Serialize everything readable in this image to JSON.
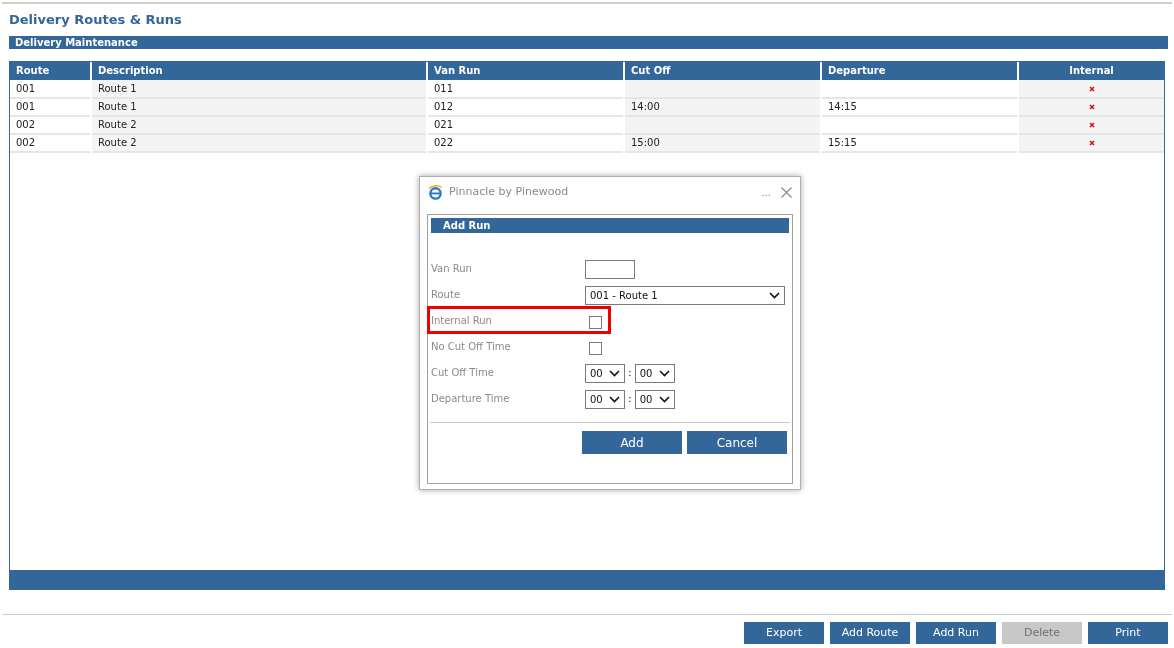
{
  "page_title": "Delivery Routes & Runs",
  "section_title": "Delivery Maintenance",
  "table": {
    "columns": [
      "Route",
      "Description",
      "Van Run",
      "Cut Off",
      "Departure",
      "Internal"
    ],
    "rows": [
      {
        "route": "001",
        "description": "Route 1",
        "van_run": "011",
        "cut_off": "",
        "departure": "",
        "internal": false
      },
      {
        "route": "001",
        "description": "Route 1",
        "van_run": "012",
        "cut_off": "14:00",
        "departure": "14:15",
        "internal": false
      },
      {
        "route": "002",
        "description": "Route 2",
        "van_run": "021",
        "cut_off": "",
        "departure": "",
        "internal": false
      },
      {
        "route": "002",
        "description": "Route 2",
        "van_run": "022",
        "cut_off": "15:00",
        "departure": "15:15",
        "internal": false
      }
    ]
  },
  "dialog": {
    "title": "Pinnacle by Pinewood",
    "menu": "...",
    "heading": "Add Run",
    "fields": [
      {
        "kind": "text",
        "label": "Van Run",
        "highlighted": false
      },
      {
        "kind": "select",
        "label": "Route",
        "value": "001 - Route 1",
        "highlighted": false
      },
      {
        "kind": "checkbox",
        "label": "Internal Run",
        "checked": false,
        "highlighted": true
      },
      {
        "kind": "checkbox",
        "label": "No Cut Off Time",
        "checked": false,
        "highlighted": false
      },
      {
        "kind": "time",
        "label": "Cut Off Time",
        "hours": "00",
        "minutes": "00",
        "separator": ":",
        "highlighted": false
      },
      {
        "kind": "time",
        "label": "Departure Time",
        "hours": "00",
        "minutes": "00",
        "separator": ":",
        "highlighted": false
      }
    ],
    "buttons": [
      {
        "label": "Add",
        "disabled": false
      },
      {
        "label": "Cancel",
        "disabled": false
      }
    ]
  },
  "buttons": [
    {
      "label": "Export",
      "disabled": false
    },
    {
      "label": "Add Route",
      "disabled": false
    },
    {
      "label": "Add Run",
      "disabled": false
    },
    {
      "label": "Delete",
      "disabled": true
    },
    {
      "label": "Print",
      "disabled": false
    }
  ]
}
